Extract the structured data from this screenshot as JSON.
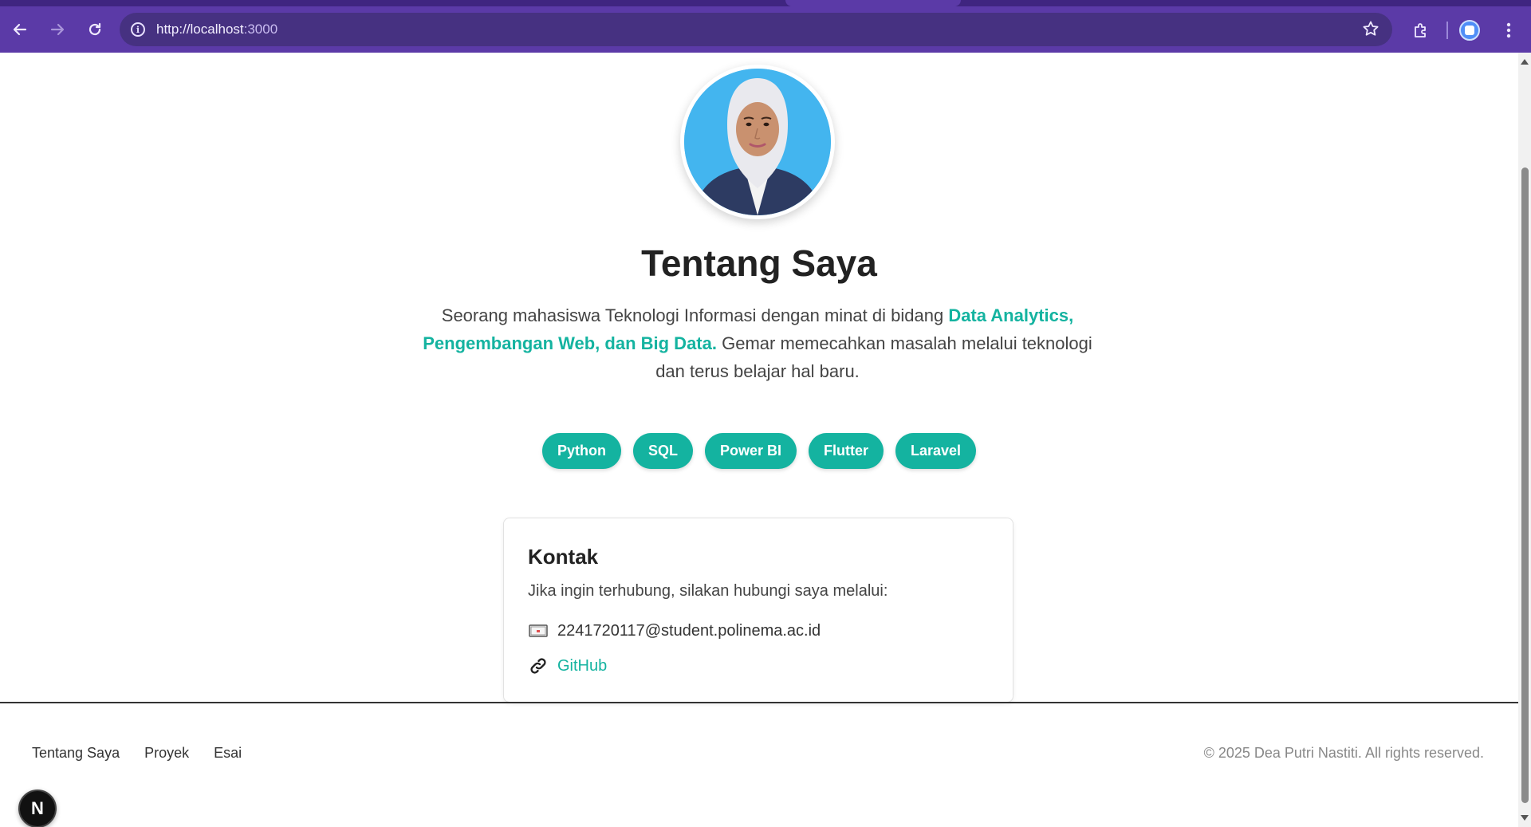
{
  "browser": {
    "url_scheme_host": "http://localhost",
    "url_port": ":3000",
    "back_icon": "arrow-left",
    "forward_icon": "arrow-right",
    "reload_icon": "reload",
    "site_info_icon": "info",
    "bookmark_icon": "star",
    "extensions_icon": "puzzle",
    "menu_icon": "kebab"
  },
  "profile": {
    "alt": "Profile photo"
  },
  "about": {
    "title": "Tentang Saya",
    "bio_part1": "Seorang mahasiswa Teknologi Informasi dengan minat di bidang ",
    "bio_highlight": "Data Analytics, Pengembangan Web, dan Big Data.",
    "bio_part2": " Gemar memecahkan masalah melalui teknologi dan terus belajar hal baru."
  },
  "skills": [
    "Python",
    "SQL",
    "Power BI",
    "Flutter",
    "Laravel"
  ],
  "contact": {
    "heading": "Kontak",
    "description": "Jika ingin terhubung, silakan hubungi saya melalui:",
    "email": "2241720117@student.polinema.ac.id",
    "github_label": "GitHub"
  },
  "footer": {
    "nav": [
      "Tentang Saya",
      "Proyek",
      "Esai"
    ],
    "copyright": "© 2025 Dea Putri Nastiti. All rights reserved."
  },
  "dev_badge": "N",
  "colors": {
    "accent": "#14b3a0",
    "browser_frame": "#5b3aa7"
  }
}
